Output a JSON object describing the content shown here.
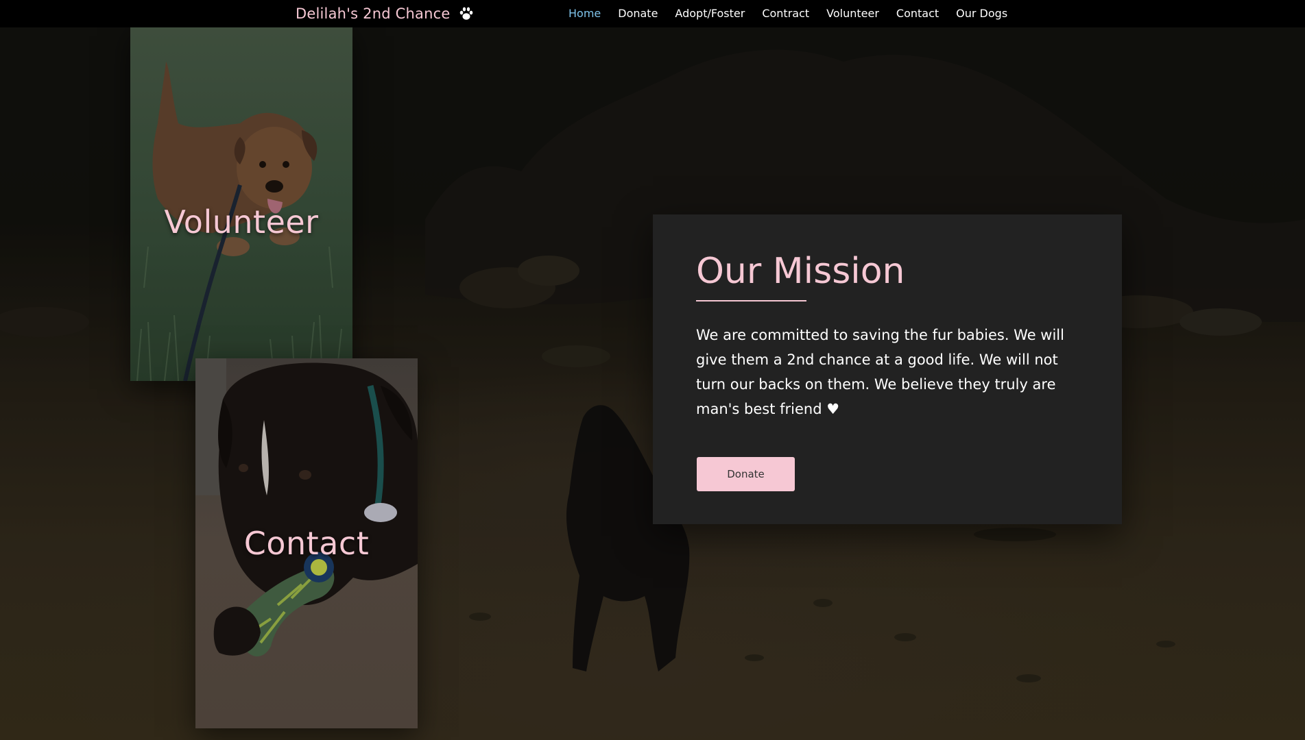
{
  "nav": {
    "brand": "Delilah's 2nd Chance",
    "brand_icon": "paw-icon",
    "links": [
      {
        "label": "Home",
        "active": true
      },
      {
        "label": "Donate",
        "active": false
      },
      {
        "label": "Adopt/Foster",
        "active": false
      },
      {
        "label": "Contract",
        "active": false
      },
      {
        "label": "Volunteer",
        "active": false
      },
      {
        "label": "Contact",
        "active": false
      },
      {
        "label": "Our Dogs",
        "active": false
      }
    ]
  },
  "cards": {
    "volunteer": {
      "title": "Volunteer"
    },
    "contact": {
      "title": "Contact"
    }
  },
  "mission": {
    "title": "Our Mission",
    "text": "We are committed to saving the fur babies. We will give them a 2nd chance at a good life. We will not turn our backs on them. We believe they truly are man's best friend ♥",
    "button_label": "Donate"
  },
  "colors": {
    "accent_pink": "#f6c8d4",
    "active_link": "#7fc3ea",
    "nav_bg": "#000000",
    "panel_bg": "#222222"
  }
}
